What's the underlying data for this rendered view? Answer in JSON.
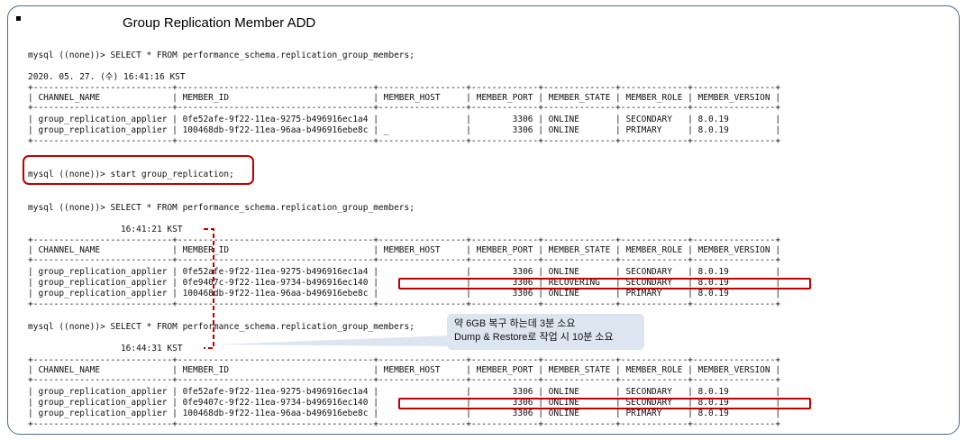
{
  "slide": {
    "title": "Group Replication Member ADD"
  },
  "terminal": {
    "blocks": [
      {
        "query": "mysql ((none))> SELECT * FROM performance_schema.replication_group_members;",
        "timestamp": "2020. 05. 27. (수) 16:41:16 KST",
        "header": "| CHANNEL_NAME              | MEMBER_ID                            | MEMBER_HOST     | MEMBER_PORT | MEMBER_STATE | MEMBER_ROLE | MEMBER_VERSION |",
        "rows": [
          "| group_replication_applier | 0fe52afe-9f22-11ea-9275-b496916ec1a4 |                 |        3306 | ONLINE       | SECONDARY   | 8.0.19         |",
          "| group_replication_applier | 100468db-9f22-11ea-96aa-b496916ebe8c | _               |        3306 | ONLINE       | PRIMARY     | 8.0.19         |"
        ]
      },
      {
        "command": "mysql ((none))> start group_replication;"
      },
      {
        "query": "mysql ((none))> SELECT * FROM performance_schema.replication_group_members;",
        "timestamp": "                  16:41:21 KST",
        "header": "| CHANNEL_NAME              | MEMBER_ID                            | MEMBER_HOST     | MEMBER_PORT | MEMBER_STATE | MEMBER_ROLE | MEMBER_VERSION |",
        "rows": [
          "| group_replication_applier | 0fe52afe-9f22-11ea-9275-b496916ec1a4 |                 |        3306 | ONLINE       | SECONDARY   | 8.0.19         |",
          "| group_replication_applier | 0fe9407c-9f22-11ea-9734-b496916ec140 |                 |        3306 | RECOVERING   | SECONDARY   | 8.0.19         |",
          "| group_replication_applier | 100468db-9f22-11ea-96aa-b496916ebe8c |                 |        3306 | ONLINE       | PRIMARY     | 8.0.19         |"
        ]
      },
      {
        "query": "mysql ((none))> SELECT * FROM performance_schema.replication_group_members;",
        "timestamp": "                  16:44:31 KST",
        "header": "| CHANNEL_NAME              | MEMBER_ID                            | MEMBER_HOST     | MEMBER_PORT | MEMBER_STATE | MEMBER_ROLE | MEMBER_VERSION |",
        "rows": [
          "| group_replication_applier | 0fe52afe-9f22-11ea-9275-b496916ec1a4 |                 |        3306 | ONLINE       | SECONDARY   | 8.0.19         |",
          "| group_replication_applier | 0fe9407c-9f22-11ea-9734-b496916ec140 |                 |        3306 | ONLINE       | SECONDARY   | 8.0.19         |",
          "| group_replication_applier | 100468db-9f22-11ea-96aa-b496916ebe8c |                 |        3306 | ONLINE       | PRIMARY     | 8.0.19         |"
        ]
      }
    ],
    "border_line": "+---------------------------+--------------------------------------+-----------------+-------------+--------------+-------------+----------------+"
  },
  "callout": {
    "line1": "약 6GB 복구 하는데 3분 소요",
    "line2": "Dump & Restore로 작업 시 10분 소요"
  },
  "colors": {
    "highlight": "#c00000",
    "frame": "#4f6b8f",
    "callout_bg": "#dde5f1"
  }
}
